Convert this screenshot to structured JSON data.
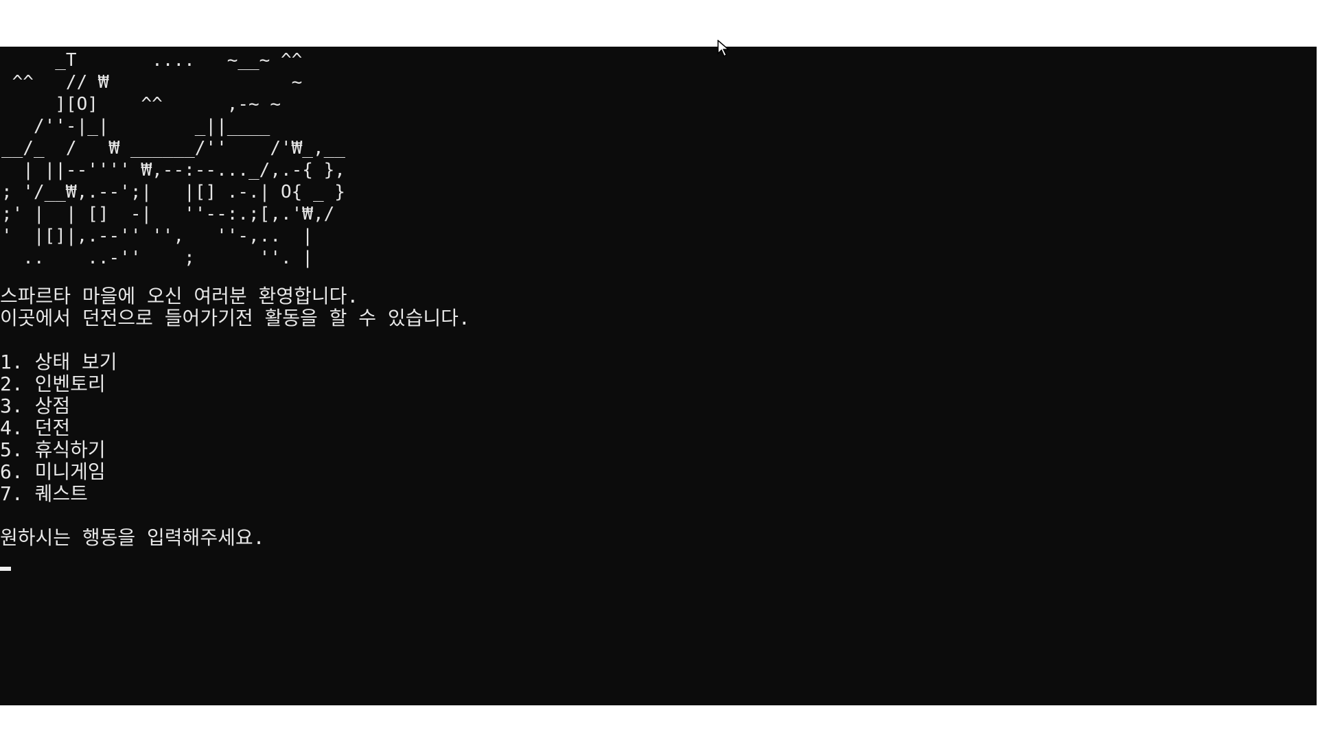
{
  "ascii_art": "     _T       ....   ~__~ ^^\n ^^   // ₩                 ~\n     ][O]    ^^      ,-~ ~\n   /''-|_|        _||____\n__/_  /   ₩ ______/''    /'₩_,__\n  | ||--'''' ₩,--:--..._/,.-{ },\n; '/__₩,.--';|   |[] .-.| O{ _ }\n;' |  | []  -|   ''--:.;[,.'₩,/\n'  |[]|,.--'' '',   ''-,..  |\n  ..    ..-''    ;      ''. |",
  "welcome": {
    "line1": "스파르타 마을에 오신 여러분 환영합니다.",
    "line2": "이곳에서 던전으로 들어가기전 활동을 할 수 있습니다."
  },
  "menu": [
    {
      "label": "1. 상태 보기"
    },
    {
      "label": "2. 인벤토리"
    },
    {
      "label": "3. 상점"
    },
    {
      "label": "4. 던전"
    },
    {
      "label": "5. 휴식하기"
    },
    {
      "label": "6. 미니게임"
    },
    {
      "label": "7. 퀘스트"
    }
  ],
  "prompt": "원하시는 행동을 입력해주세요.",
  "colors": {
    "background": "#0c0c0c",
    "text": "#e8e8e8",
    "outer": "#ffffff"
  },
  "icons": {
    "mouse": "mouse-pointer-icon",
    "cursor": "text-cursor-icon"
  }
}
